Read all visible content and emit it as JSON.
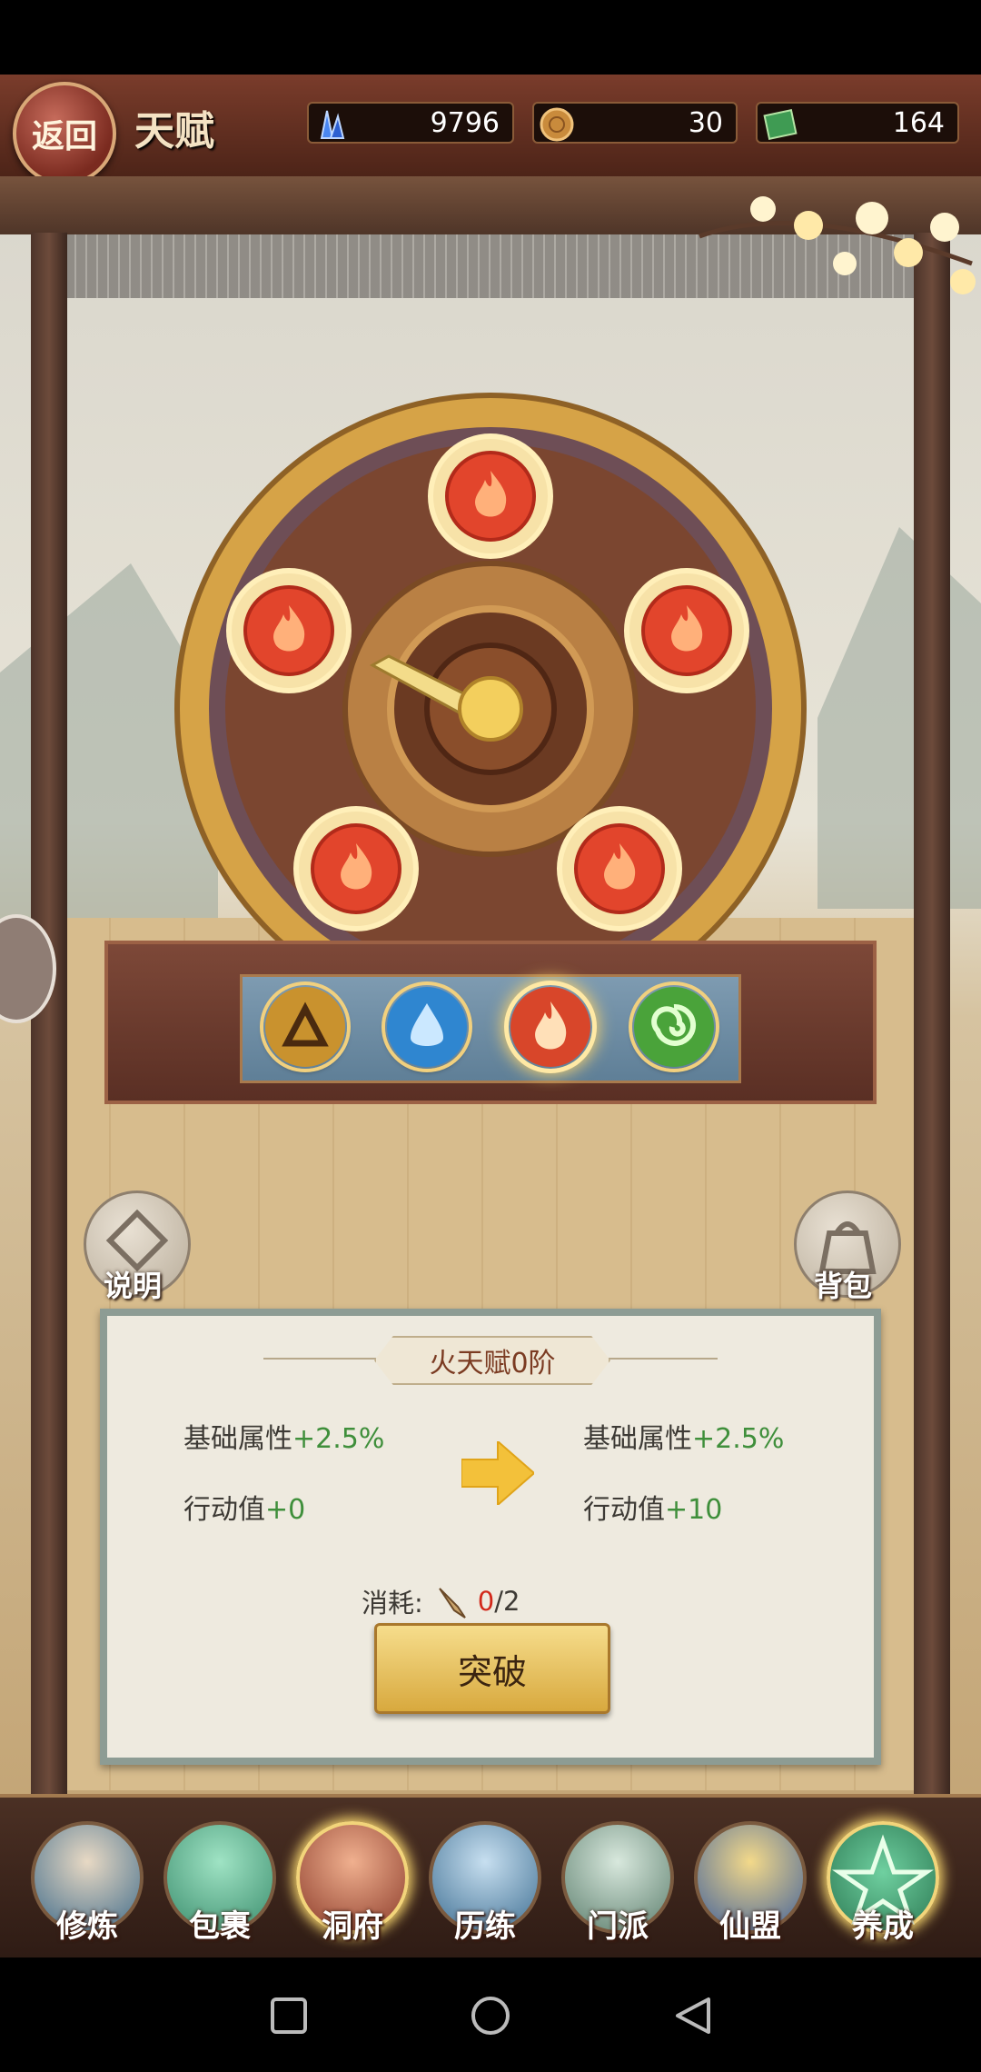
{
  "header": {
    "back_label": "返回",
    "title": "天赋",
    "resources": [
      {
        "icon": "crystal-icon",
        "value": "9796"
      },
      {
        "icon": "coin-icon",
        "value": "30"
      },
      {
        "icon": "book-icon",
        "value": "164"
      }
    ]
  },
  "wheel": {
    "slots": [
      "fire-icon",
      "fire-icon",
      "fire-icon",
      "fire-icon",
      "fire-icon"
    ],
    "elements": [
      {
        "icon": "earth-icon",
        "color": "#c9922e"
      },
      {
        "icon": "water-icon",
        "color": "#2f86d0"
      },
      {
        "icon": "fire-icon",
        "color": "#d8462a",
        "active": true
      },
      {
        "icon": "wood-icon",
        "color": "#4aa33a"
      }
    ]
  },
  "side_buttons": {
    "help_label": "说明",
    "bag_label": "背包"
  },
  "panel": {
    "title": "火天赋0阶",
    "current": [
      {
        "label": "基础属性",
        "value": "+2.5%"
      },
      {
        "label": "行动值",
        "value": "+0"
      }
    ],
    "next": [
      {
        "label": "基础属性",
        "value": "+2.5%"
      },
      {
        "label": "行动值",
        "value": "+10"
      }
    ],
    "cost_label": "消耗:",
    "cost_have": "0",
    "cost_need": "/2",
    "button_label": "突破"
  },
  "nav": [
    {
      "label": "修炼",
      "icon": "cultivator-icon",
      "color": "#3f6b8a"
    },
    {
      "label": "包裹",
      "icon": "bag-icon",
      "color": "#3b8d6d"
    },
    {
      "label": "洞府",
      "icon": "palace-icon",
      "color": "#8b3b2a",
      "active": true
    },
    {
      "label": "历练",
      "icon": "scroll-icon",
      "color": "#3f6f92"
    },
    {
      "label": "门派",
      "icon": "gate-icon",
      "color": "#5d7f6e"
    },
    {
      "label": "仙盟",
      "icon": "alliance-icon",
      "color": "#3f5f9a"
    },
    {
      "label": "养成",
      "icon": "pentagram-icon",
      "color": "#2d7a54"
    }
  ]
}
